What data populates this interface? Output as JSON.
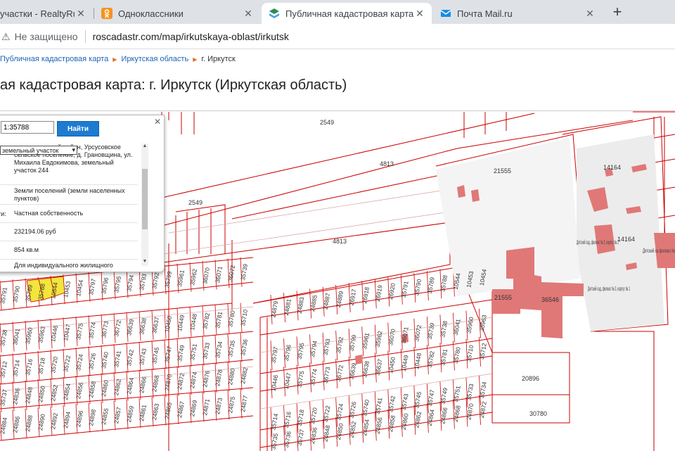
{
  "tabs": [
    {
      "title": "участки - RealtyRule",
      "active": false
    },
    {
      "title": "Одноклассники",
      "active": false
    },
    {
      "title": "Публичная кадастровая карта: г",
      "active": true
    },
    {
      "title": "Почта Mail.ru",
      "active": false
    }
  ],
  "new_tab_icon": "plus-icon",
  "omnibox": {
    "security_text": "Не защищено",
    "url": "roscadastr.com/map/irkutskaya-oblast/irkutsk"
  },
  "breadcrumb": [
    "Публичная кадастровая карта",
    "Иркутская область",
    "г. Иркутск"
  ],
  "page_title": "ая кадастровая карта: г. Иркутск (Иркутская область)",
  "search": {
    "value": "1:35788",
    "button": "Найти",
    "type_value": "земельный участок"
  },
  "info_rows": [
    {
      "label": "",
      "value": "муниципальный район, Урсусовское сельское поселение, д. Грановщина, ул. Михаила Евдокимова, земельный участок 244"
    },
    {
      "label": "",
      "value": "Земли поселений (земли населенных пунктов)"
    },
    {
      "label": "ти:",
      "value": "Частная собственность"
    },
    {
      "label": "",
      "value": "232194.06 руб"
    },
    {
      "label": "",
      "value": "854 кв.м"
    },
    {
      "label": "",
      "value": "Для индивидуального жилищного"
    }
  ],
  "map_labels": {
    "big": [
      "2549",
      "4813",
      "2549",
      "4813",
      "21555",
      "14164",
      "14164",
      "21555",
      "36546",
      "20896",
      "30780"
    ],
    "kinder": [
      "Детский сад, филиал № 3, корпус № 2",
      "Детский сад, филиал № 3, корпус № 1",
      "Детский са филиал №"
    ],
    "plots": [
      "35791",
      "35790",
      "35789",
      "35788",
      "10544",
      "10453",
      "10454",
      "35797",
      "35796",
      "35795",
      "35794",
      "35793",
      "35792",
      "35799",
      "35961",
      "35962",
      "36070",
      "36071",
      "36072",
      "35739",
      "35738",
      "36041",
      "35960",
      "35963",
      "10446",
      "10447",
      "35775",
      "35774",
      "36773",
      "36772",
      "36639",
      "36638",
      "36637",
      "10450",
      "10449",
      "10448",
      "35782",
      "35781",
      "35780",
      "35710",
      "35712",
      "35714",
      "35716",
      "35718",
      "35720",
      "35722",
      "35724",
      "35726",
      "35740",
      "35741",
      "35742",
      "35743",
      "35745",
      "35747",
      "35749",
      "35751",
      "35733",
      "35734",
      "35735",
      "35736",
      "35737",
      "24836",
      "24848",
      "24850",
      "24852",
      "24854",
      "24856",
      "24858",
      "24860",
      "24862",
      "24864",
      "24866",
      "24868",
      "24870",
      "24872",
      "24874",
      "24876",
      "24878",
      "24880",
      "24882",
      "24884",
      "24886",
      "24888",
      "24890",
      "24892",
      "24894",
      "24896",
      "24898",
      "24855",
      "24857",
      "24859",
      "24861",
      "24863",
      "24865",
      "24867",
      "24869",
      "24871",
      "24873",
      "24875",
      "24877",
      "24879",
      "24881",
      "24883",
      "24885",
      "24887",
      "24889",
      "26917",
      "26918",
      "26919",
      "26920"
    ]
  }
}
